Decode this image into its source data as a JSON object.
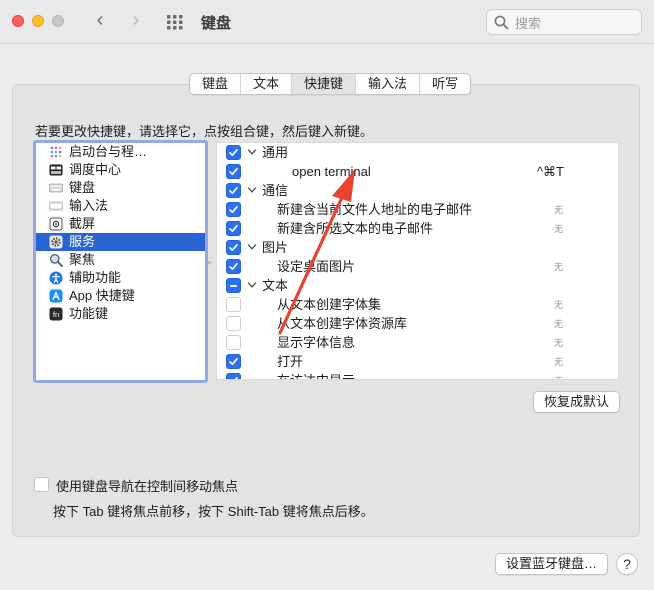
{
  "window": {
    "title": "键盘"
  },
  "search": {
    "placeholder": "搜索"
  },
  "tabs": [
    {
      "label": "键盘",
      "active": false
    },
    {
      "label": "文本",
      "active": false
    },
    {
      "label": "快捷键",
      "active": true
    },
    {
      "label": "输入法",
      "active": false
    },
    {
      "label": "听写",
      "active": false
    }
  ],
  "instruction": "若要更改快捷键，请选择它，点按组合键，然后键入新键。",
  "categories": [
    {
      "label": "启动台与程…",
      "icon": "launchpad-icon",
      "selected": false
    },
    {
      "label": "调度中心",
      "icon": "mission-control-icon",
      "selected": false
    },
    {
      "label": "键盘",
      "icon": "keyboard-icon",
      "selected": false
    },
    {
      "label": "输入法",
      "icon": "input-sources-icon",
      "selected": false
    },
    {
      "label": "截屏",
      "icon": "screenshot-icon",
      "selected": false
    },
    {
      "label": "服务",
      "icon": "services-gear-icon",
      "selected": true
    },
    {
      "label": "聚焦",
      "icon": "spotlight-icon",
      "selected": false
    },
    {
      "label": "辅助功能",
      "icon": "accessibility-icon",
      "selected": false
    },
    {
      "label": "App 快捷键",
      "icon": "app-shortcuts-icon",
      "selected": false
    },
    {
      "label": "功能键",
      "icon": "function-keys-icon",
      "selected": false
    }
  ],
  "shortcuts": [
    {
      "type": "group",
      "label": "通用",
      "checked": "on"
    },
    {
      "type": "item",
      "label": "open terminal",
      "checked": "on",
      "shortcut": "^⌘T",
      "indent": "special"
    },
    {
      "type": "group",
      "label": "通信",
      "checked": "on"
    },
    {
      "type": "item",
      "label": "新建含当前文件人地址的电子邮件",
      "checked": "on",
      "shortcut": "无"
    },
    {
      "type": "item",
      "label": "新建含所选文本的电子邮件",
      "checked": "on",
      "shortcut": "无"
    },
    {
      "type": "group",
      "label": "图片",
      "checked": "on"
    },
    {
      "type": "item",
      "label": "设定桌面图片",
      "checked": "on",
      "shortcut": "无"
    },
    {
      "type": "group",
      "label": "文本",
      "checked": "mixed"
    },
    {
      "type": "item",
      "label": "从文本创建字体集",
      "checked": "off",
      "shortcut": "无"
    },
    {
      "type": "item",
      "label": "从文本创建字体资源库",
      "checked": "off",
      "shortcut": "无"
    },
    {
      "type": "item",
      "label": "显示字体信息",
      "checked": "off",
      "shortcut": "无"
    },
    {
      "type": "item",
      "label": "打开",
      "checked": "on",
      "shortcut": "无"
    },
    {
      "type": "item",
      "label": "在访达中显示",
      "checked": "on",
      "shortcut": "无"
    }
  ],
  "buttons": {
    "restore_defaults": "恢复成默认",
    "bluetooth_keyboard": "设置蓝牙键盘…",
    "help": "?"
  },
  "keyboard_navigation": {
    "label": "使用键盘导航在控制间移动焦点",
    "checked": false,
    "hint": "按下 Tab 键将焦点前移，按下 Shift-Tab 键将焦点后移。"
  },
  "colors": {
    "accent": "#2a6ff4",
    "selection": "#2a63d4",
    "annotation_arrow": "#e8432e"
  }
}
